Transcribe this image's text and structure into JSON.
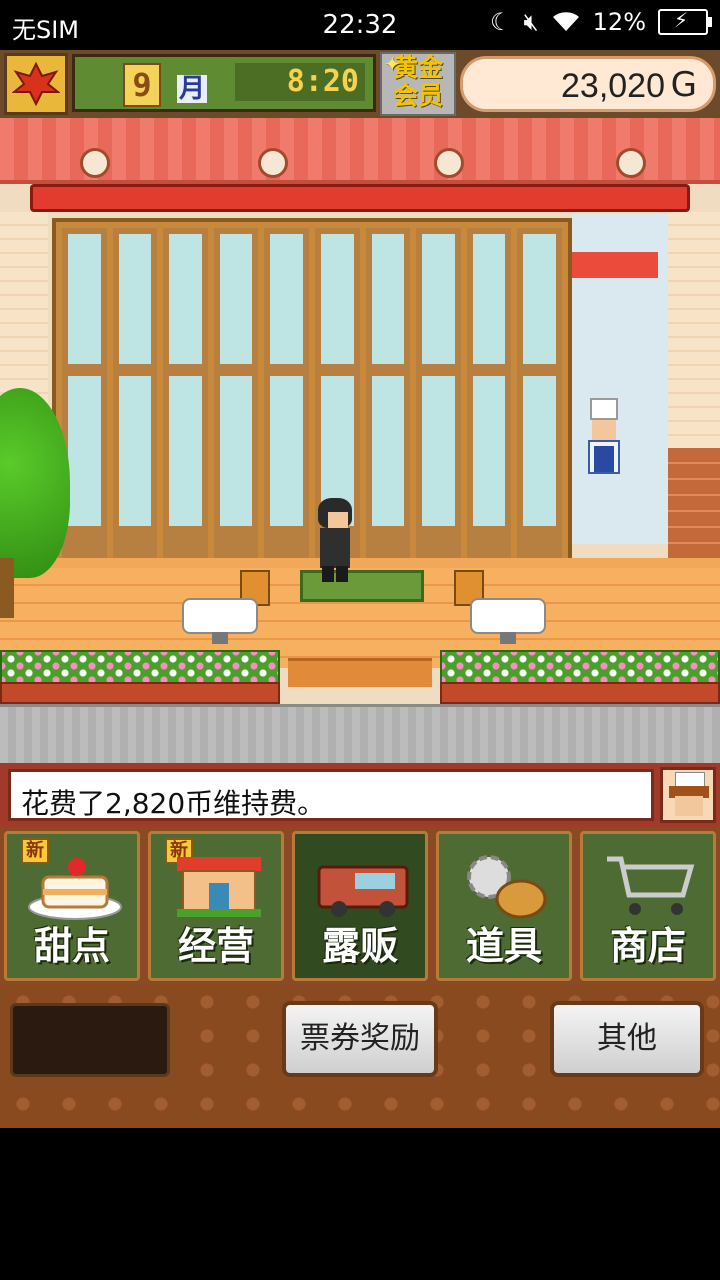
{
  "status_bar": {
    "carrier": "无SIM",
    "time": "22:32",
    "battery": "12%"
  },
  "hud": {
    "month": "9",
    "month_label": "月",
    "clock": "8:20",
    "gold_member": [
      "黄金",
      "会员"
    ],
    "money": "23,020",
    "currency": "G"
  },
  "message": {
    "text": "花费了2,820币维持费。"
  },
  "menu": {
    "items": [
      {
        "label": "甜点",
        "badge": "新"
      },
      {
        "label": "经营",
        "badge": "新"
      },
      {
        "label": "露贩",
        "badge": ""
      },
      {
        "label": "道具",
        "badge": ""
      },
      {
        "label": "商店",
        "badge": ""
      }
    ]
  },
  "bottom": {
    "ticket_button": "票券奖励",
    "other_button": "其他"
  },
  "icons": [
    "autumn-leaf-icon",
    "cake-icon",
    "shop-icon",
    "food-truck-icon",
    "gear-bag-icon",
    "shopping-cart-icon"
  ]
}
